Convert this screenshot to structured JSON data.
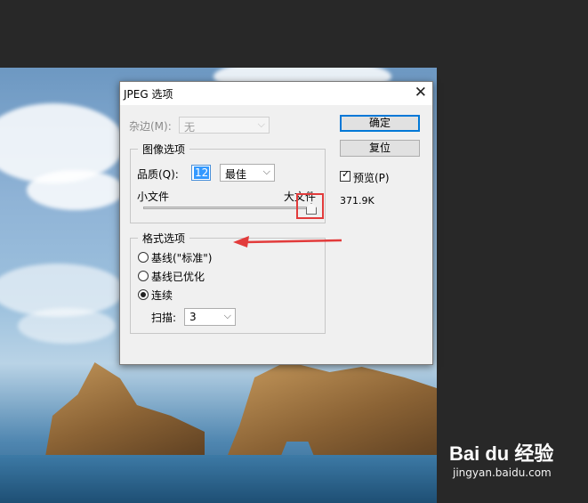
{
  "dialog": {
    "title": "JPEG 选项",
    "matte_label": "杂边(M):",
    "matte_value": "无",
    "buttons": {
      "ok": "确定",
      "reset": "复位"
    },
    "preview_label": "预览(P)",
    "preview_checked": true,
    "file_size": "371.9K"
  },
  "image_options": {
    "group_title": "图像选项",
    "quality_label": "品质(Q):",
    "quality_value": "12",
    "quality_preset": "最佳",
    "small_file_label": "小文件",
    "large_file_label": "大文件",
    "slider_level": 1.0
  },
  "format_options": {
    "group_title": "格式选项",
    "radios": [
      {
        "label": "基线(\"标准\")",
        "checked": false
      },
      {
        "label": "基线已优化",
        "checked": false
      },
      {
        "label": "连续",
        "checked": true
      }
    ],
    "scans_label": "扫描:",
    "scans_value": "3"
  },
  "watermark": {
    "logo": "Bai du 经验",
    "url": "jingyan.baidu.com"
  },
  "colors": {
    "annotation_red": "#e23b3b",
    "focus_blue": "#0078d7"
  }
}
